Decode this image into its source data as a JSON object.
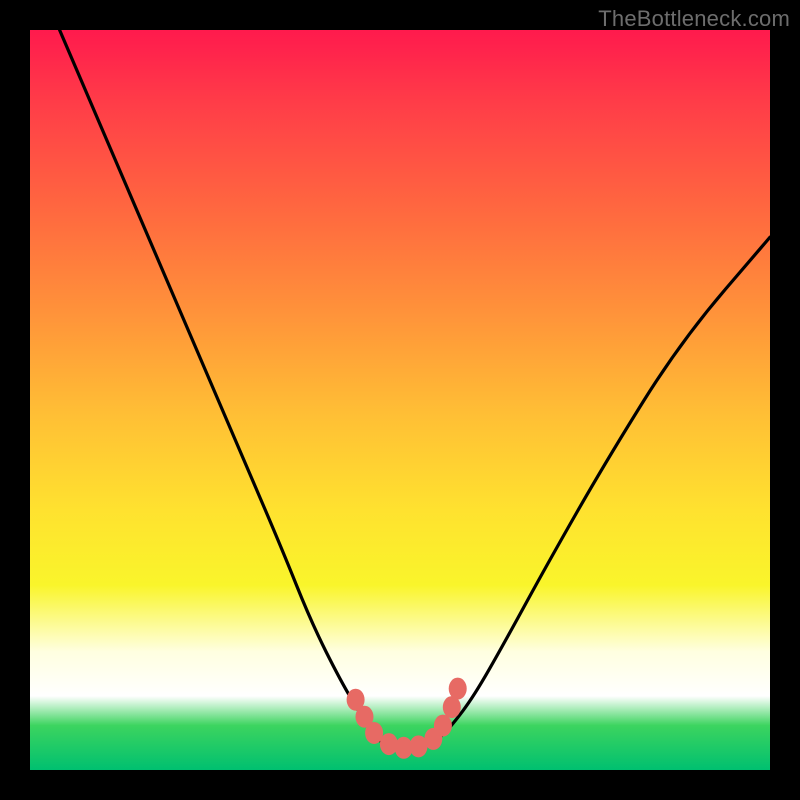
{
  "watermark": "TheBottleneck.com",
  "chart_data": {
    "type": "line",
    "title": "",
    "xlabel": "",
    "ylabel": "",
    "xlim": [
      0,
      100
    ],
    "ylim": [
      0,
      100
    ],
    "series": [
      {
        "name": "bottleneck-curve",
        "x": [
          4,
          10,
          16,
          22,
          28,
          34,
          38,
          42,
          45,
          47,
          49,
          51,
          53,
          55,
          57,
          60,
          64,
          70,
          78,
          88,
          100
        ],
        "values": [
          100,
          86,
          72,
          58,
          44,
          30,
          20,
          12,
          7,
          4,
          3,
          3,
          3,
          4,
          6,
          10,
          17,
          28,
          42,
          58,
          72
        ]
      }
    ],
    "markers": {
      "name": "highlight-dots",
      "color": "#e76a64",
      "x": [
        44,
        45.2,
        46.5,
        48.5,
        50.5,
        52.5,
        54.5,
        55.8,
        57,
        57.8
      ],
      "values": [
        9.5,
        7.2,
        5.0,
        3.5,
        3.0,
        3.2,
        4.2,
        6.0,
        8.5,
        11.0
      ]
    },
    "gradient_stops": [
      {
        "pos": 0,
        "color": "#ff1a4d"
      },
      {
        "pos": 10,
        "color": "#ff3d48"
      },
      {
        "pos": 25,
        "color": "#ff6a3f"
      },
      {
        "pos": 38,
        "color": "#ff923a"
      },
      {
        "pos": 52,
        "color": "#ffbf35"
      },
      {
        "pos": 65,
        "color": "#ffe22f"
      },
      {
        "pos": 75,
        "color": "#f9f52b"
      },
      {
        "pos": 84,
        "color": "#ffffe0"
      },
      {
        "pos": 90,
        "color": "#ffffff"
      },
      {
        "pos": 94,
        "color": "#3cd45f"
      },
      {
        "pos": 100,
        "color": "#00c070"
      }
    ]
  }
}
